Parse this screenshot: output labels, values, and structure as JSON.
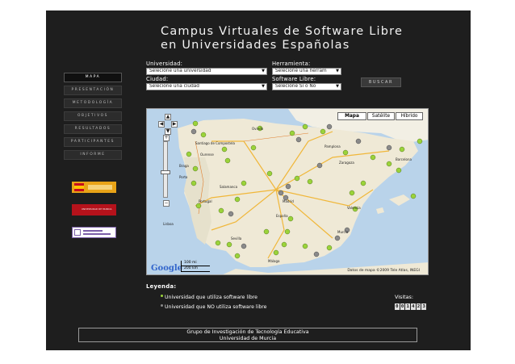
{
  "header": {
    "title_line1": "Campus Virtuales de Software Libre",
    "title_line2": "en Universidades Españolas"
  },
  "filters": {
    "universidad_label": "Universidad:",
    "universidad_value": "Selecione una universidad",
    "herramienta_label": "Herramienta:",
    "herramienta_value": "Selecione una herram",
    "ciudad_label": "Ciudad:",
    "ciudad_value": "Selecione una ciudad",
    "software_label": "Software Libre:",
    "software_value": "Selecione Si o No",
    "search_label": "BUSCAR"
  },
  "nav": {
    "items": [
      {
        "label": "MAPA",
        "active": true
      },
      {
        "label": "PRESENTACIÓN",
        "active": false
      },
      {
        "label": "METODOLOGÍA",
        "active": false
      },
      {
        "label": "OBJETIVOS",
        "active": false
      },
      {
        "label": "RESULTADOS",
        "active": false
      },
      {
        "label": "PARTICIPANTES",
        "active": false
      },
      {
        "label": "INFORME",
        "active": false
      }
    ]
  },
  "logos": {
    "murcia_text": "UNIVERSIDAD DE MURCIA"
  },
  "map": {
    "type_buttons": [
      "Mapa",
      "Satélite",
      "Híbrido"
    ],
    "active_type": "Mapa",
    "copyright": "Datos de mapa ©2009 Tele Atlas, INEGI",
    "google": "Google",
    "scale_mi": "100 mi",
    "scale_km": "200 km",
    "cities": {
      "oviedo": "Oviedo",
      "santiago": "Santiago de Compostela",
      "ourense": "Ourense",
      "braga": "Braga",
      "porto": "Porto",
      "portugal": "Portugal",
      "lisboa": "Lisboa",
      "madrid": "Madrid",
      "espana": "España",
      "valencia": "Valencia",
      "barcelona": "Barcelona",
      "zaragoza": "Zaragoza",
      "malaga": "Málaga",
      "sevilla": "Sevilla",
      "murcia": "Murcia",
      "pamplona": "Pamplona",
      "salamanca": "Salamanca"
    },
    "colors": {
      "sw_libre": "#9bd33a",
      "no_sw_libre": "#8a8a8a"
    }
  },
  "legend": {
    "title": "Leyenda:",
    "item1": "Universidad que utiliza software libre",
    "item2": "Universidad que NO utiliza software libre"
  },
  "visits": {
    "label": "Visitas:",
    "digits": [
      "0",
      "0",
      "1",
      "4",
      "2",
      "3"
    ]
  },
  "footer": {
    "line1": "Grupo de Investigación de Tecnología Educativa",
    "line2": "Universidad de Murcia"
  }
}
